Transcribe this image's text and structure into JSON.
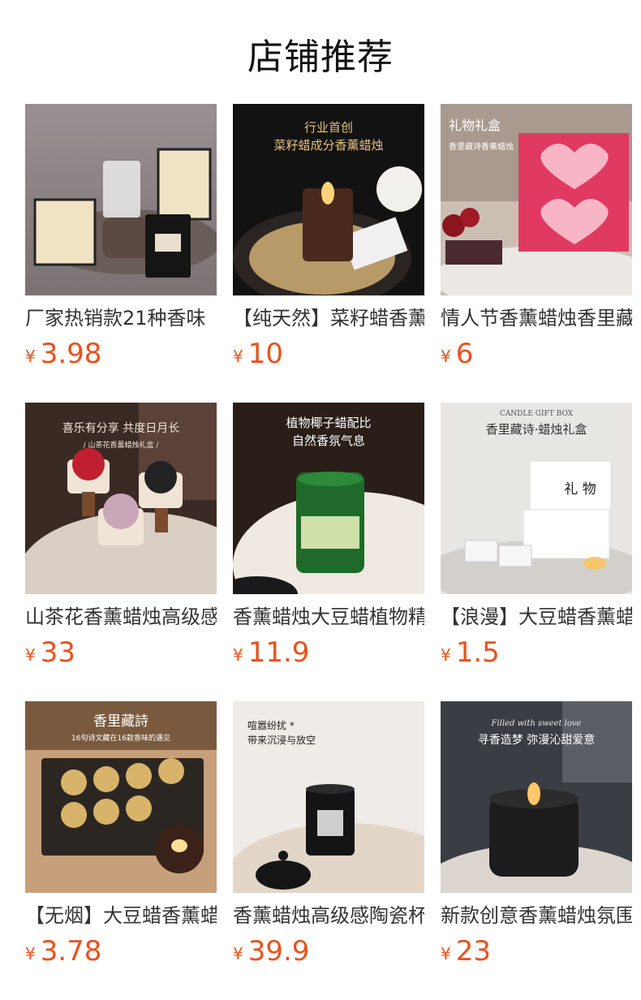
{
  "header": {
    "title": "店铺推荐"
  },
  "products": [
    {
      "name": "厂家热销款21种香味",
      "currency": "¥",
      "price": "3.98"
    },
    {
      "name": "【纯天然】菜籽蜡香薰",
      "currency": "¥",
      "price": "10",
      "image_text": [
        "行业首创",
        "菜籽蜡成分香薰蜡烛"
      ]
    },
    {
      "name": "情人节香薰蜡烛香里藏诗",
      "currency": "¥",
      "price": "6",
      "image_text": [
        "礼物礼盒",
        "香里藏诗香薰蜡烛"
      ]
    },
    {
      "name": "山茶花香薰蜡烛高级感",
      "currency": "¥",
      "price": "33",
      "image_text": [
        "喜乐有分享 共度日月长",
        "/ 山茶花香薰蜡烛礼盒 /"
      ]
    },
    {
      "name": "香薰蜡烛大豆蜡植物精油",
      "currency": "¥",
      "price": "11.9",
      "image_text": [
        "植物椰子蜡配比",
        "自然香氛气息"
      ]
    },
    {
      "name": "【浪漫】大豆蜡香薰蜡烛",
      "currency": "¥",
      "price": "1.5",
      "image_text": [
        "CANDLE GIFT BOX",
        "香里藏诗·蜡烛礼盒",
        "礼 物"
      ]
    },
    {
      "name": "【无烟】大豆蜡香薰蜡烛",
      "currency": "¥",
      "price": "3.78",
      "image_text": [
        "香里藏詩",
        "16句诗文藏在16款香味的遇见"
      ]
    },
    {
      "name": "香薰蜡烛高级感陶瓷杯",
      "currency": "¥",
      "price": "39.9",
      "image_text": [
        "喧嚣纷扰 *",
        "带来沉浸与放空"
      ]
    },
    {
      "name": "新款创意香薰蜡烛氛围",
      "currency": "¥",
      "price": "23",
      "image_text": [
        "Filled with sweet love",
        "寻香造梦 弥漫沁甜爱意"
      ]
    }
  ]
}
